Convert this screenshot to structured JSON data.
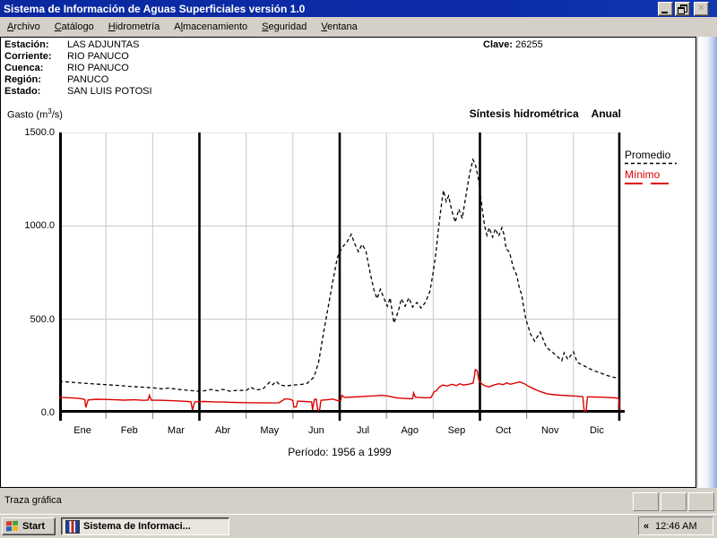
{
  "window": {
    "title": "Sistema de Información de Aguas Superficiales  versión 1.0",
    "icons": {
      "minimize": "css-shape-underscore",
      "restore": "css-shape-two-windows",
      "close": "×"
    }
  },
  "menu": {
    "items": [
      {
        "label": "Archivo",
        "mnemonic_index": 0
      },
      {
        "label": "Catálogo",
        "mnemonic_index": 0
      },
      {
        "label": "Hidrometría",
        "mnemonic_index": 0
      },
      {
        "label": "Almacenamiento",
        "mnemonic_index": 1
      },
      {
        "label": "Seguridad",
        "mnemonic_index": 0
      },
      {
        "label": "Ventana",
        "mnemonic_index": 0
      }
    ]
  },
  "station": {
    "rows": [
      {
        "label": "Estación:",
        "value": "LAS ADJUNTAS"
      },
      {
        "label": "Corriente:",
        "value": "RIO PANUCO"
      },
      {
        "label": "Cuenca:",
        "value": "RIO PANUCO"
      },
      {
        "label": "Región:",
        "value": "PANUCO"
      },
      {
        "label": "Estado:",
        "value": "SAN LUIS POTOSI"
      }
    ],
    "clave_label": "Clave:",
    "clave_value": "26255"
  },
  "chart_header": {
    "y_title_pre": "Gasto (m",
    "y_title_sup": "3",
    "y_title_post": "/s)",
    "subtitle": "Síntesis hidrométrica",
    "mode": "Anual",
    "period": "Período:  1956 a 1999"
  },
  "chart_data": {
    "type": "line",
    "title": "Síntesis hidrométrica Anual",
    "ylabel": "Gasto (m³/s)",
    "xlabel": "Período: 1956 a 1999",
    "ylim": [
      0,
      1500
    ],
    "y_ticks": [
      {
        "label": "1500.0",
        "value": 1500
      },
      {
        "label": "1000.0",
        "value": 1000
      },
      {
        "label": "500.0",
        "value": 500
      },
      {
        "label": "0.0",
        "value": 0
      }
    ],
    "categories": [
      "Ene",
      "Feb",
      "Mar",
      "Abr",
      "May",
      "Jun",
      "Jul",
      "Ago",
      "Sep",
      "Oct",
      "Nov",
      "Dic"
    ],
    "quarter_dividers": [
      3,
      6,
      9
    ],
    "grid": true,
    "legend_position": "right",
    "colors": {
      "promedio": "#000000",
      "minimo": "#dd0000",
      "grid": "#c8c8c8"
    },
    "series": [
      {
        "name": "Promedio",
        "style": "dashed",
        "color": "#000000",
        "points": [
          [
            0,
            168
          ],
          [
            0.25,
            163
          ],
          [
            0.5,
            158
          ],
          [
            0.75,
            154
          ],
          [
            1,
            150
          ],
          [
            1.25,
            146
          ],
          [
            1.5,
            141
          ],
          [
            1.75,
            137
          ],
          [
            2,
            133
          ],
          [
            2.2,
            128
          ],
          [
            2.35,
            132
          ],
          [
            2.5,
            126
          ],
          [
            2.75,
            120
          ],
          [
            3,
            114
          ],
          [
            3.1,
            117
          ],
          [
            3.25,
            124
          ],
          [
            3.4,
            117
          ],
          [
            3.5,
            125
          ],
          [
            3.65,
            115
          ],
          [
            3.8,
            120
          ],
          [
            4,
            119
          ],
          [
            4.1,
            136
          ],
          [
            4.2,
            122
          ],
          [
            4.35,
            125
          ],
          [
            4.5,
            163
          ],
          [
            4.57,
            150
          ],
          [
            4.64,
            168
          ],
          [
            4.72,
            148
          ],
          [
            4.85,
            143
          ],
          [
            5,
            148
          ],
          [
            5.15,
            150
          ],
          [
            5.3,
            156
          ],
          [
            5.45,
            190
          ],
          [
            5.55,
            270
          ],
          [
            5.65,
            420
          ],
          [
            5.75,
            560
          ],
          [
            5.85,
            700
          ],
          [
            5.95,
            830
          ],
          [
            6.05,
            885
          ],
          [
            6.15,
            910
          ],
          [
            6.25,
            955
          ],
          [
            6.32,
            905
          ],
          [
            6.4,
            862
          ],
          [
            6.48,
            901
          ],
          [
            6.56,
            868
          ],
          [
            6.65,
            750
          ],
          [
            6.73,
            660
          ],
          [
            6.8,
            610
          ],
          [
            6.87,
            661
          ],
          [
            6.95,
            610
          ],
          [
            7.02,
            570
          ],
          [
            7.08,
            615
          ],
          [
            7.16,
            480
          ],
          [
            7.25,
            540
          ],
          [
            7.32,
            610
          ],
          [
            7.4,
            570
          ],
          [
            7.48,
            615
          ],
          [
            7.56,
            565
          ],
          [
            7.65,
            590
          ],
          [
            7.74,
            560
          ],
          [
            7.83,
            590
          ],
          [
            7.93,
            650
          ],
          [
            8,
            750
          ],
          [
            8.06,
            860
          ],
          [
            8.12,
            1000
          ],
          [
            8.18,
            1120
          ],
          [
            8.22,
            1190
          ],
          [
            8.28,
            1130
          ],
          [
            8.33,
            1160
          ],
          [
            8.4,
            1080
          ],
          [
            8.47,
            1020
          ],
          [
            8.55,
            1090
          ],
          [
            8.62,
            1040
          ],
          [
            8.7,
            1160
          ],
          [
            8.78,
            1280
          ],
          [
            8.85,
            1355
          ],
          [
            8.9,
            1330
          ],
          [
            8.97,
            1250
          ],
          [
            9.05,
            1090
          ],
          [
            9.1,
            1000
          ],
          [
            9.15,
            950
          ],
          [
            9.2,
            990
          ],
          [
            9.27,
            940
          ],
          [
            9.33,
            985
          ],
          [
            9.4,
            945
          ],
          [
            9.47,
            990
          ],
          [
            9.52,
            950
          ],
          [
            9.56,
            877
          ],
          [
            9.63,
            860
          ],
          [
            9.71,
            781
          ],
          [
            9.79,
            733
          ],
          [
            9.85,
            660
          ],
          [
            9.89,
            637
          ],
          [
            9.94,
            560
          ],
          [
            9.98,
            503
          ],
          [
            10.08,
            422
          ],
          [
            10.17,
            383
          ],
          [
            10.29,
            431
          ],
          [
            10.42,
            350
          ],
          [
            10.56,
            321
          ],
          [
            10.66,
            300
          ],
          [
            10.75,
            278
          ],
          [
            10.8,
            321
          ],
          [
            10.88,
            285
          ],
          [
            11,
            326
          ],
          [
            11.08,
            270
          ],
          [
            11.13,
            263
          ],
          [
            11.24,
            249
          ],
          [
            11.35,
            235
          ],
          [
            11.44,
            225
          ],
          [
            11.55,
            215
          ],
          [
            11.7,
            201
          ],
          [
            11.85,
            190
          ],
          [
            12,
            182
          ]
        ]
      },
      {
        "name": "Mínimo",
        "style": "solid",
        "color": "#dd0000",
        "points": [
          [
            0,
            82
          ],
          [
            0.2,
            80
          ],
          [
            0.4,
            77
          ],
          [
            0.5,
            74
          ],
          [
            0.55,
            70
          ],
          [
            0.57,
            28
          ],
          [
            0.62,
            68
          ],
          [
            0.8,
            72
          ],
          [
            1,
            71
          ],
          [
            1.2,
            69
          ],
          [
            1.4,
            67
          ],
          [
            1.6,
            69
          ],
          [
            1.8,
            66
          ],
          [
            1.9,
            67
          ],
          [
            1.93,
            93
          ],
          [
            1.97,
            67
          ],
          [
            2.2,
            66
          ],
          [
            2.4,
            64
          ],
          [
            2.6,
            62
          ],
          [
            2.75,
            60
          ],
          [
            2.82,
            58
          ],
          [
            2.85,
            15
          ],
          [
            2.9,
            58
          ],
          [
            3.1,
            60
          ],
          [
            3.3,
            58
          ],
          [
            3.5,
            57
          ],
          [
            3.7,
            55
          ],
          [
            3.9,
            54
          ],
          [
            4.1,
            53
          ],
          [
            4.3,
            53
          ],
          [
            4.5,
            52
          ],
          [
            4.7,
            53
          ],
          [
            4.83,
            74
          ],
          [
            4.95,
            72
          ],
          [
            5,
            64
          ],
          [
            5.02,
            30
          ],
          [
            5.07,
            30
          ],
          [
            5.1,
            62
          ],
          [
            5.25,
            60
          ],
          [
            5.4,
            58
          ],
          [
            5.42,
            15
          ],
          [
            5.46,
            70
          ],
          [
            5.5,
            72
          ],
          [
            5.53,
            14
          ],
          [
            5.57,
            14
          ],
          [
            5.6,
            66
          ],
          [
            5.75,
            70
          ],
          [
            5.85,
            73
          ],
          [
            5.95,
            65
          ],
          [
            6.02,
            65
          ],
          [
            6.05,
            93
          ],
          [
            6.1,
            82
          ],
          [
            6.3,
            84
          ],
          [
            6.45,
            86
          ],
          [
            6.6,
            88
          ],
          [
            6.75,
            90
          ],
          [
            6.9,
            93
          ],
          [
            7.05,
            88
          ],
          [
            7.2,
            80
          ],
          [
            7.35,
            77
          ],
          [
            7.5,
            75
          ],
          [
            7.56,
            75
          ],
          [
            7.58,
            106
          ],
          [
            7.62,
            83
          ],
          [
            7.8,
            80
          ],
          [
            7.95,
            80
          ],
          [
            8.02,
            112
          ],
          [
            8.08,
            120
          ],
          [
            8.12,
            135
          ],
          [
            8.2,
            148
          ],
          [
            8.3,
            143
          ],
          [
            8.4,
            152
          ],
          [
            8.5,
            145
          ],
          [
            8.57,
            155
          ],
          [
            8.65,
            148
          ],
          [
            8.75,
            152
          ],
          [
            8.85,
            158
          ],
          [
            8.88,
            190
          ],
          [
            8.9,
            230
          ],
          [
            8.94,
            225
          ],
          [
            8.98,
            170
          ],
          [
            9.05,
            152
          ],
          [
            9.12,
            143
          ],
          [
            9.2,
            138
          ],
          [
            9.3,
            148
          ],
          [
            9.4,
            155
          ],
          [
            9.5,
            150
          ],
          [
            9.57,
            160
          ],
          [
            9.65,
            152
          ],
          [
            9.75,
            158
          ],
          [
            9.85,
            165
          ],
          [
            9.95,
            155
          ],
          [
            10.05,
            140
          ],
          [
            10.15,
            128
          ],
          [
            10.3,
            112
          ],
          [
            10.45,
            100
          ],
          [
            10.6,
            96
          ],
          [
            10.75,
            93
          ],
          [
            10.9,
            91
          ],
          [
            11.05,
            89
          ],
          [
            11.15,
            87
          ],
          [
            11.2,
            86
          ],
          [
            11.23,
            8
          ],
          [
            11.27,
            8
          ],
          [
            11.3,
            85
          ],
          [
            11.45,
            84
          ],
          [
            11.6,
            83
          ],
          [
            11.75,
            81
          ],
          [
            11.9,
            79
          ],
          [
            11.97,
            76
          ],
          [
            12,
            10
          ]
        ]
      }
    ]
  },
  "legend": {
    "items": [
      {
        "label": "Promedio",
        "color": "#000000",
        "dash": "4 3"
      },
      {
        "label": "Mínimo",
        "color": "#dd0000",
        "dash": "20 9"
      }
    ]
  },
  "status_bar": {
    "text": "Traza gráfica"
  },
  "taskbar": {
    "start_label": "Start",
    "task_label": "Sistema de Informaci...",
    "tray_button": "«",
    "clock": "12:46 AM"
  }
}
